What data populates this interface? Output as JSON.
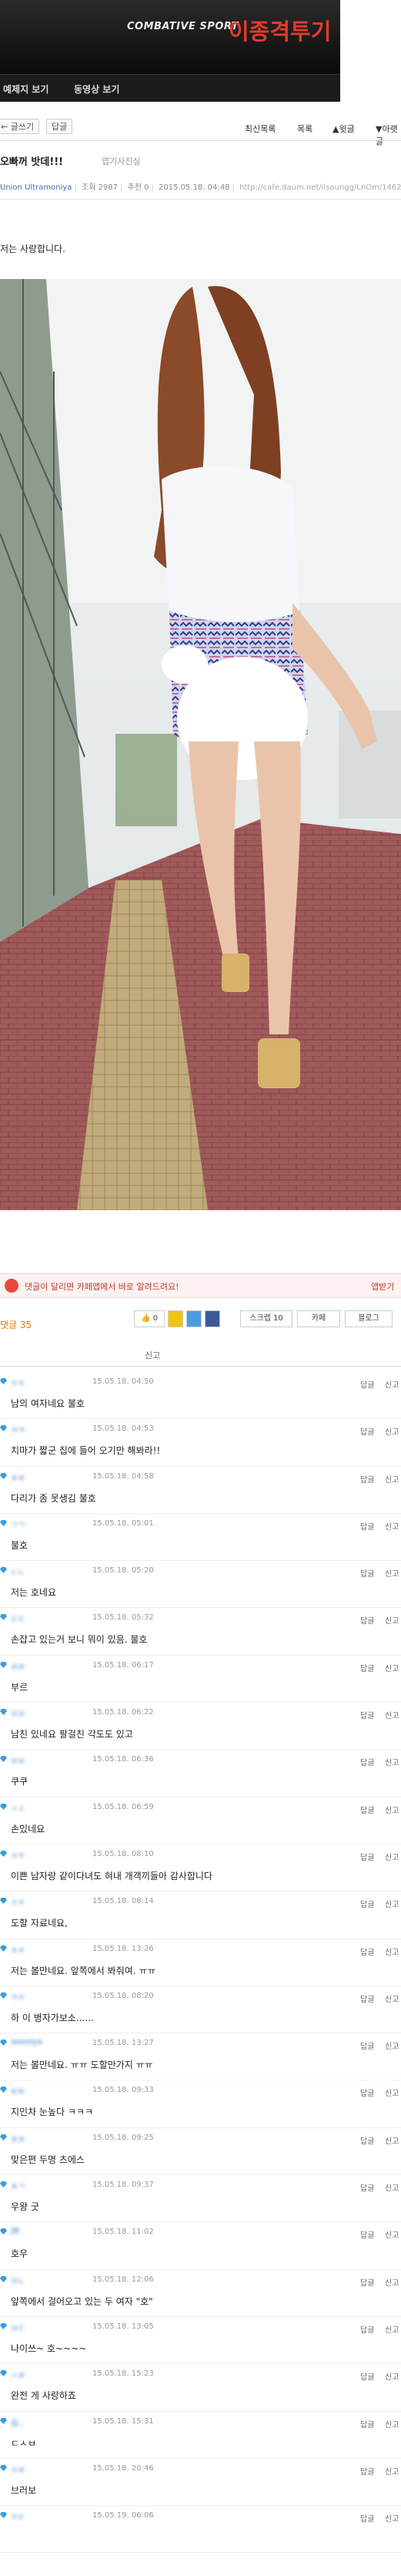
{
  "banner": {
    "sport_label": "COMBATIVE SPORT",
    "title": "이종격투기",
    "nav": [
      "예제지 보기",
      "동영상 보기"
    ]
  },
  "toolbar": {
    "left_buttons": [
      "← 글쓰기",
      "답글"
    ],
    "right_links": [
      "최신목록",
      "목록",
      "▲윗글",
      "▼아랫글"
    ]
  },
  "post": {
    "title": "오빠꺼 밧데!!!",
    "category": "엽기사진실",
    "author": "Union Ultramoniya",
    "views": "조회 2987",
    "recommend": "추천 0",
    "date": "2015.05.18. 04:48",
    "url": "http://cafe.daum.net/ilsaungg/LnOm/1462665",
    "body_text": "저는 사랑합니다.",
    "photo_alt": "사진"
  },
  "comments_section": {
    "share_text": "댓글이 달리면 카페앱에서 바로 알려드려요!",
    "share_link": "앱받기",
    "count_label": "댓글 35",
    "share_buttons": [
      "0",
      "",
      "",
      "",
      "스크랩 10",
      "카페",
      "블로그"
    ],
    "report_label": "신고",
    "reply_label": "답글",
    "report_item_label": "신고"
  },
  "comments": [
    {
      "nick": "ㅇㅇ",
      "date": "15.05.18. 04:50",
      "text": "남의 여자네요 불호"
    },
    {
      "nick": "ㅋㅋ",
      "date": "15.05.18. 04:53",
      "text": "치마가 짧군 집에 들어 오기만 해봐라!!"
    },
    {
      "nick": "ㅎㅎ",
      "date": "15.05.18. 04:58",
      "text": "다리가 좀 못생김 불호"
    },
    {
      "nick": "ㄱㄱ",
      "date": "15.05.18. 05:01",
      "text": "불호"
    },
    {
      "nick": "ㄴㄴ",
      "date": "15.05.18. 05:20",
      "text": "저는 호네요"
    },
    {
      "nick": "ㄷㄷ",
      "date": "15.05.18. 05:32",
      "text": "손잡고 있는거 보니 뭐이 있음. 불호"
    },
    {
      "nick": "ㄹㄹ",
      "date": "15.05.18. 06:17",
      "text": "부르"
    },
    {
      "nick": "ㅁㅁ",
      "date": "15.05.18. 06:22",
      "text": "남친 있네요 팔걸친 각도도 있고"
    },
    {
      "nick": "ㅂㅂ",
      "date": "15.05.18. 06:36",
      "text": "쿠쿠"
    },
    {
      "nick": "ㅅㅅ",
      "date": "15.05.18. 06:59",
      "text": "손있네요"
    },
    {
      "nick": "ㅇㅈ",
      "date": "15.05.18. 08:10",
      "text": "이쁜 남자랑 같이다녀도 혀내 개객끼들아 감사합니다"
    },
    {
      "nick": "ㅈㅈ",
      "date": "15.05.18. 08:14",
      "text": "도할 자료네요,"
    },
    {
      "nick": "ㅊㅊ",
      "date": "15.05.18. 13:26",
      "text": "저는 볼만네요. 앞쪽에서 봐줘여. ㅠㅠ"
    },
    {
      "nick": "ㅋㅈ",
      "date": "15.05.18. 08:20",
      "text": "하 이 병자가보소......"
    },
    {
      "nick": "moniya",
      "date": "15.05.18. 13:27",
      "text": "저는 볼만네요. ㅠㅠ 도할만가지 ㅠㅠ"
    },
    {
      "nick": "ㅌㅌ",
      "date": "15.05.18. 09:33",
      "text": "지인차 눈높다 ㅋㅋㅋ"
    },
    {
      "nick": "ㅍㅍ",
      "date": "15.05.18. 09:25",
      "text": "맞은편 두명 츠에스"
    },
    {
      "nick": "ㅎㄱ",
      "date": "15.05.18. 09:37",
      "text": "우왕 굿"
    },
    {
      "nick": "JB",
      "date": "15.05.18. 11:02",
      "text": "호우"
    },
    {
      "nick": "ㅁㄴ",
      "date": "15.05.18. 12:06",
      "text": "앞쪽에서 걸어오고 있는 두 여자 \"호\""
    },
    {
      "nick": "ㅂㄷ",
      "date": "15.05.18. 13:05",
      "text": "나이쓰~ 호~~~~"
    },
    {
      "nick": "ㅅㄹ",
      "date": "15.05.18. 15:23",
      "text": "완전 게 사랑하죠"
    },
    {
      "nick": "김..",
      "date": "15.05.18. 15:31",
      "text": "ㄷㅅㅂ"
    },
    {
      "nick": "ㅇㄹ",
      "date": "15.05.18. 20:46",
      "text": "브러보"
    },
    {
      "nick": "ㅈㄷ",
      "date": "15.05.19. 06:06",
      "text": ""
    }
  ]
}
